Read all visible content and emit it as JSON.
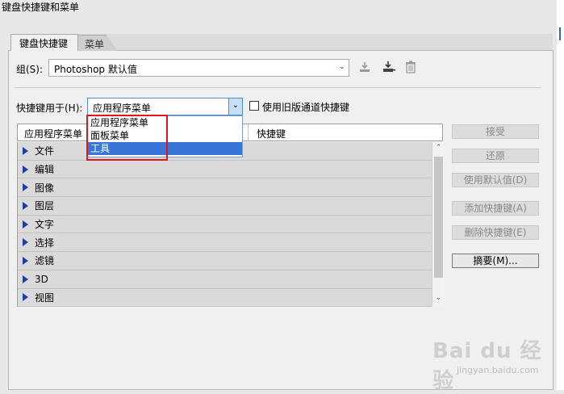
{
  "window": {
    "title": "键盘快捷键和菜单"
  },
  "tabs": [
    {
      "label": "键盘快捷键"
    },
    {
      "label": "菜单"
    }
  ],
  "set": {
    "label": "组(S):",
    "value": "Photoshop 默认值"
  },
  "shortcuts_for": {
    "label": "快捷键用于(H):",
    "value": "应用程序菜单",
    "legacy_checkbox_label": "使用旧版通道快捷键",
    "legacy_checked": false
  },
  "dropdown": {
    "options": [
      "应用程序菜单",
      "面板菜单",
      "工具"
    ],
    "selected": "工具"
  },
  "table": {
    "headers": [
      "应用程序菜单",
      "快捷键"
    ],
    "rows": [
      "文件",
      "编辑",
      "图像",
      "图层",
      "文字",
      "选择",
      "滤镜",
      "3D",
      "视图"
    ]
  },
  "side_buttons": {
    "accept": "接受",
    "undo": "还原",
    "use_default": "使用默认值(D)",
    "add_shortcut": "添加快捷键(A)",
    "delete_shortcut": "删除快捷键(E)",
    "summarize": "摘要(M)..."
  },
  "icons": {
    "save_set": "save-icon",
    "save_as": "save-as-icon",
    "delete_set": "trash-icon"
  },
  "watermark": {
    "main": "Bai du 经验",
    "sub": "jingyan.baidu.com"
  },
  "colors": {
    "selection": "#3875d7",
    "annotation_box": "#e0161e",
    "expand_arrow": "#1d3fa0"
  }
}
